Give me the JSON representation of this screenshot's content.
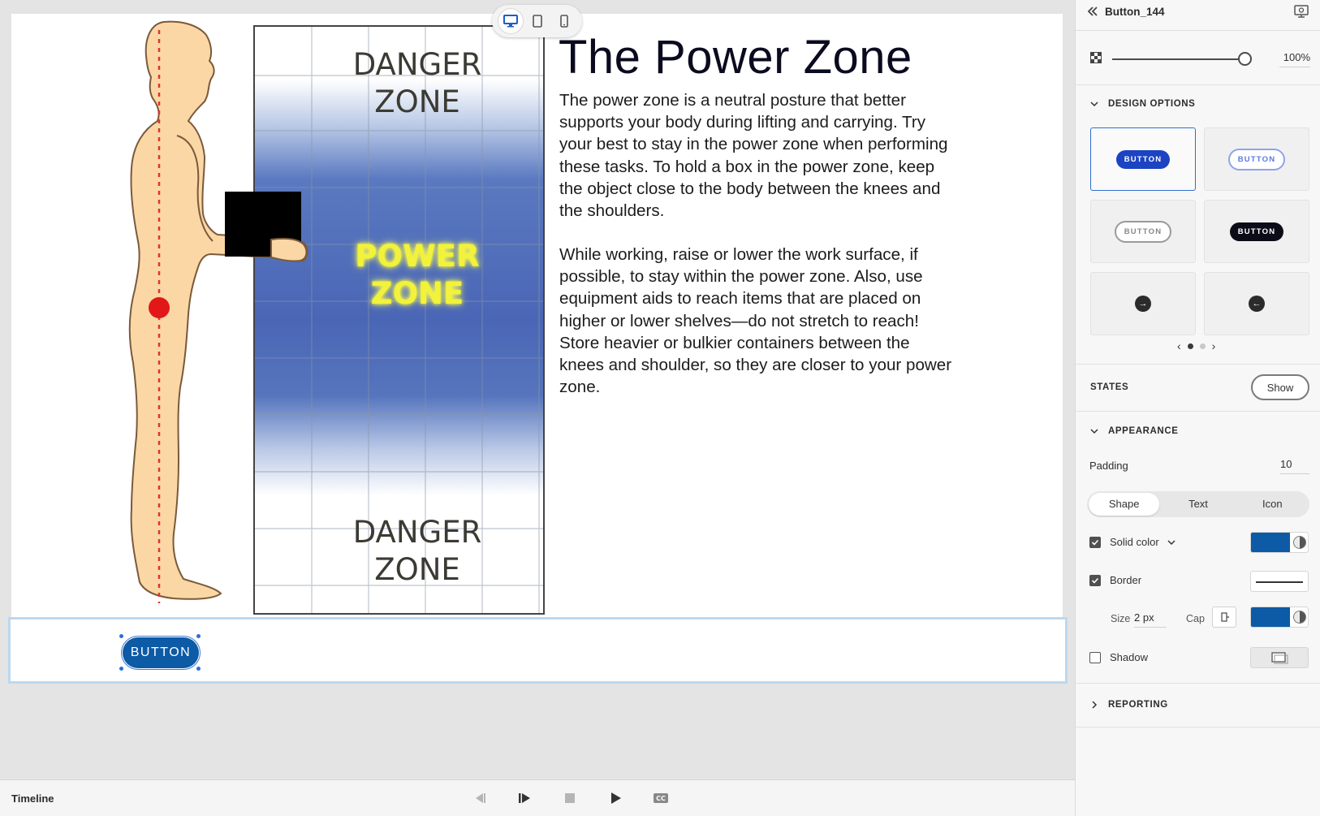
{
  "slide": {
    "title": "The Power Zone",
    "paragraph1": "The power zone is a neutral posture that better supports your body during lifting and carrying. Try your best to stay in the power zone when performing these tasks. To hold a box in the power zone, keep the object close to the body between the knees and the shoulders.",
    "paragraph2": "While working, raise or lower the work surface, if possible, to stay within the power zone. Also, use equipment aids to reach items that are placed on higher or lower shelves—do not stretch to reach! Store heavier or bulkier containers between the knees and shoulder, so they are closer to your power zone.",
    "illustration": {
      "danger_top_line1": "DANGER",
      "danger_top_line2": "ZONE",
      "power_line1": "POWER",
      "power_line2": "ZONE",
      "danger_bottom_line1": "DANGER",
      "danger_bottom_line2": "ZONE"
    },
    "button_label": "BUTTON"
  },
  "device_switcher": {
    "items": [
      {
        "icon": "desktop-icon",
        "active": true
      },
      {
        "icon": "tablet-icon",
        "active": false
      },
      {
        "icon": "phone-icon",
        "active": false
      }
    ]
  },
  "timeline": {
    "label": "Timeline",
    "controls": [
      "rewind-icon",
      "play-from-icon",
      "stop-icon",
      "play-icon",
      "closed-captions-icon"
    ]
  },
  "panel": {
    "title": "Button_144",
    "opacity": {
      "value_text": "100%",
      "value": 1.0
    },
    "design_options": {
      "heading": "DESIGN OPTIONS",
      "styles": [
        {
          "label": "BUTTON",
          "variant": "filled-blue",
          "selected": true
        },
        {
          "label": "BUTTON",
          "variant": "outline-blue",
          "selected": false
        },
        {
          "label": "BUTTON",
          "variant": "outline-grey",
          "selected": false
        },
        {
          "label": "BUTTON",
          "variant": "filled-dark",
          "selected": false
        },
        {
          "label": "",
          "variant": "arrow-right-circle",
          "selected": false
        },
        {
          "label": "",
          "variant": "arrow-left-circle",
          "selected": false
        }
      ],
      "page": 1,
      "page_count": 2
    },
    "states": {
      "heading": "STATES",
      "show_label": "Show"
    },
    "appearance": {
      "heading": "APPEARANCE",
      "padding_label": "Padding",
      "padding_value": "10",
      "tabs": [
        "Shape",
        "Text",
        "Icon"
      ],
      "active_tab": "Shape",
      "solid_color_label": "Solid color",
      "solid_color_checked": true,
      "fill_color": "#0d5aa6",
      "border_label": "Border",
      "border_checked": true,
      "size_label": "Size",
      "size_value": "2 px",
      "cap_label": "Cap",
      "border_color": "#0d5aa6",
      "shadow_label": "Shadow",
      "shadow_checked": false
    },
    "reporting": {
      "heading": "REPORTING"
    }
  },
  "colors": {
    "accent": "#2f6fd1",
    "button_fill": "#0d5aa6",
    "selection": "#bcd8f0"
  }
}
